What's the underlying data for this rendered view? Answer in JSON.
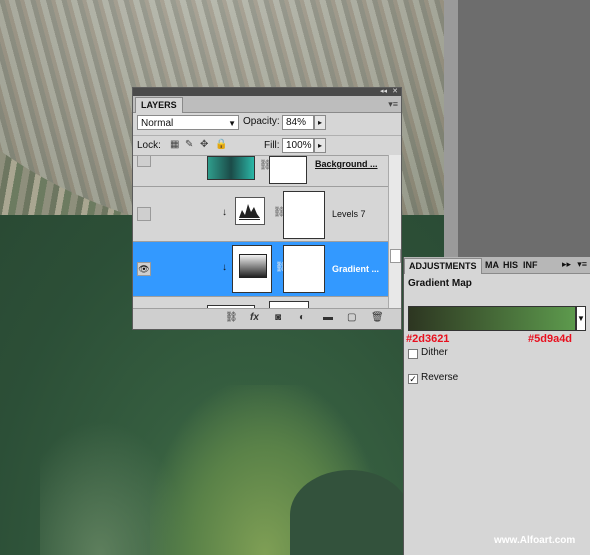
{
  "layers_panel": {
    "tab_label": "LAYERS",
    "blend_mode": "Normal",
    "opacity_label": "Opacity:",
    "opacity_value": "84%",
    "lock_label": "Lock:",
    "fill_label": "Fill:",
    "fill_value": "100%",
    "layers": [
      {
        "name": "Background ...",
        "type": "image",
        "visible": false,
        "selected": false
      },
      {
        "name": "Levels 7",
        "type": "levels-adjustment",
        "visible": false,
        "selected": false
      },
      {
        "name": "Gradient ...",
        "type": "gradient-map-adjustment",
        "visible": true,
        "selected": true
      },
      {
        "name": "",
        "type": "image",
        "visible": false,
        "selected": false
      }
    ],
    "selection_color": "#3399ff"
  },
  "adjustments_panel": {
    "tabs": [
      "ADJUSTMENTS",
      "MA",
      "HIS",
      "INF"
    ],
    "active_tab": "ADJUSTMENTS",
    "title": "Gradient Map",
    "gradient_start_hex": "#2d3621",
    "gradient_end_hex": "#5d9a4d",
    "dither_label": "Dither",
    "dither_checked": false,
    "reverse_label": "Reverse",
    "reverse_checked": true
  },
  "watermark": "www.Alfoart.com",
  "colors": {
    "panel_bg": "#d6d6d6",
    "annotation_red": "#e8101f",
    "workspace_gray": "#6d6d6d"
  }
}
